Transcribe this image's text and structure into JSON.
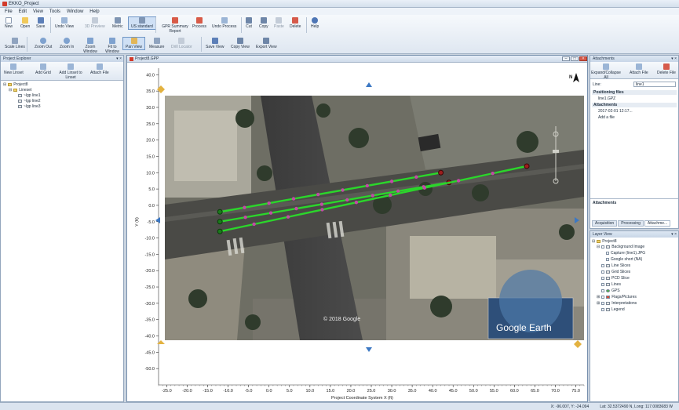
{
  "title": "EKKO_Project",
  "menu": [
    "File",
    "Edit",
    "View",
    "Tools",
    "Window",
    "Help"
  ],
  "ribbon": {
    "buttons": [
      {
        "label": "New"
      },
      {
        "label": "Open"
      },
      {
        "label": "Save"
      },
      {
        "label": "Undo View"
      },
      {
        "label": "3D Preview"
      },
      {
        "label": "Metric"
      },
      {
        "label": "US standard"
      },
      {
        "label": "GPR Summary Report"
      },
      {
        "label": "Process"
      },
      {
        "label": "Undo Process"
      },
      {
        "label": "Cut"
      },
      {
        "label": "Copy"
      },
      {
        "label": "Paste"
      },
      {
        "label": "Delete"
      },
      {
        "label": "Help"
      }
    ],
    "buttons2": [
      {
        "label": "Scale Lines"
      },
      {
        "label": "Zoom Out"
      },
      {
        "label": "Zoom In"
      },
      {
        "label": "Zoom Window"
      },
      {
        "label": "Fit to Window"
      },
      {
        "label": "Pan View"
      },
      {
        "label": "Measure"
      },
      {
        "label": "Drill Locator"
      },
      {
        "label": "Save View"
      },
      {
        "label": "Copy View"
      },
      {
        "label": "Export View"
      }
    ]
  },
  "project_explorer": {
    "title": "Project Explorer",
    "buttons": [
      "New Linset",
      "Add Grid",
      "Add Linset to Linset",
      "Attach File"
    ],
    "tree": [
      "Project8",
      "Lineset",
      "~lgp line1",
      "~lgp line2",
      "~lgp line3"
    ]
  },
  "map_window": {
    "title": "Project8.GPP",
    "watermark": "© 2018 Google",
    "google_earth": "Google Earth",
    "north": "N",
    "x_axis_label": "Project Coordinate System X (ft)",
    "y_axis_label": "Y (ft)"
  },
  "chart_data": {
    "type": "map",
    "x_ticks": [
      -25,
      -20,
      -15,
      -10,
      -5,
      0,
      5,
      10,
      15,
      20,
      25,
      30,
      35,
      40,
      45,
      50,
      55,
      60,
      65,
      70,
      75
    ],
    "y_ticks": [
      40,
      35,
      30,
      25,
      20,
      15,
      10,
      5,
      0,
      -5,
      -10,
      -15,
      -20,
      -25,
      -30,
      -35,
      -40,
      -45,
      -50
    ],
    "x_tick_labels": [
      "-25.0",
      "-20.0",
      "-15.0",
      "-10.0",
      "-5.0",
      "0.0",
      "5.0",
      "10.0",
      "15.0",
      "20.0",
      "25.0",
      "30.0",
      "35.0",
      "40.0",
      "45.0",
      "50.0",
      "55.0",
      "60.0",
      "65.0",
      "70.0",
      "75.0"
    ],
    "y_tick_labels": [
      "40.0",
      "35.0",
      "30.0",
      "25.0",
      "20.0",
      "15.0",
      "10.0",
      "5.0",
      "0.0",
      "-5.0",
      "-10.0",
      "-15.0",
      "-20.0",
      "-25.0",
      "-30.0",
      "-35.0",
      "-40.0",
      "-45.0",
      "-50.0"
    ],
    "xlim": [
      -27,
      77
    ],
    "ylim": [
      -55,
      42
    ],
    "lines": [
      {
        "x0": -12,
        "y0": -2,
        "x1": 42,
        "y1": 10
      },
      {
        "x0": -12,
        "y0": -5,
        "x1": 44,
        "y1": 7
      },
      {
        "x0": -12,
        "y0": -8,
        "x1": 63,
        "y1": 12
      }
    ]
  },
  "attachments": {
    "title": "Attachments",
    "buttons": [
      "Expand/Collapse All",
      "Attach File",
      "Delete File"
    ],
    "line_label": "Line:",
    "line_value": "line1",
    "rows": [
      "Positioning files",
      "line1.GPZ",
      "Attachments",
      "2017-02-01 12:17...",
      "Add a file"
    ],
    "footer": "Attachments",
    "tabs": [
      "Acquisition",
      "Processing",
      "Attachme..."
    ]
  },
  "layer_view": {
    "title": "Layer View",
    "tree": [
      "Project8",
      "Background Image",
      "Capture (line1).JPG",
      "Google short (NA)",
      "Line Slices",
      "Grid Slices",
      "PCD Slice",
      "Lines",
      "GPS",
      "Flags/Pictures",
      "Interpretations",
      "Legend"
    ]
  },
  "status": {
    "coords": "X: -96.007, Y: -24.094",
    "latlong": "Lat: 32.5372490 N, Long: 117.0083683 W"
  }
}
